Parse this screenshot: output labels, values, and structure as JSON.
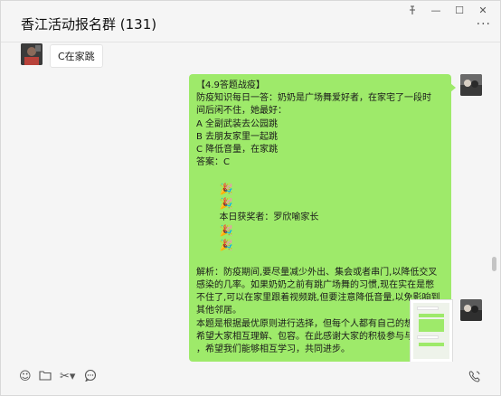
{
  "window": {
    "pin_icon": "pin-icon",
    "minimize": "—",
    "maximize": "☐",
    "close": "✕"
  },
  "chat": {
    "title": "香江活动报名群 (131)",
    "more": "···"
  },
  "messages": {
    "left_bubble": "C在家跳",
    "green_bubble": {
      "lines": [
        "【4.9答题战疫】",
        "防疫知识每日一答：奶奶是广场舞爱好者，在家宅了一段时",
        "间后闲不住，她最好：",
        "A 全副武装去公园跳",
        "B 去朋友家里一起跳",
        "C 降低音量，在家跳",
        "答案：C"
      ],
      "winner_text": "本日获奖者：罗欣喻家长",
      "analysis_lines": [
        "解析：防疫期间,要尽量减少外出、集会或者串门,以降低交叉",
        "感染的几率。如果奶奶之前有跳广场舞的习惯,现在实在是憋",
        "不住了,可以在家里跟着视频跳,但要注意降低音量,以免影响到",
        "其他邻居。",
        "本题是根据最优原则进行选择，但每个人都有自己的想法，",
        "希望大家相互理解、包容。在此感谢大家的积极参与与发言",
        "，希望我们能够相互学习，共同进步。"
      ]
    }
  },
  "toolbar": {
    "emoji_icon": "☺",
    "folder_icon": "🗀",
    "scissors_icon": "✂▾",
    "chat_icon": "💬",
    "video_icon": "☏"
  }
}
